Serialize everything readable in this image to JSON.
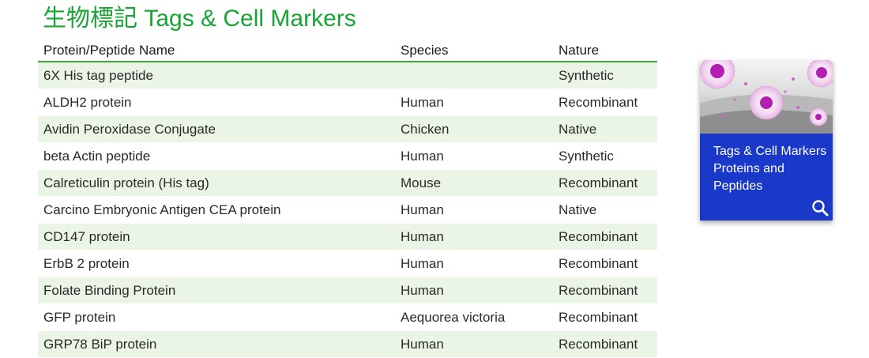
{
  "page": {
    "title": "生物標記 Tags & Cell Markers"
  },
  "table": {
    "headers": [
      "Protein/Peptide Name",
      "Species",
      "Nature"
    ],
    "rows": [
      [
        "6X His tag peptide",
        "",
        "Synthetic"
      ],
      [
        "ALDH2 protein",
        "Human",
        "Recombinant"
      ],
      [
        "Avidin Peroxidase Conjugate",
        "Chicken",
        "Native"
      ],
      [
        "beta Actin peptide",
        "Human",
        "Synthetic"
      ],
      [
        "Calreticulin protein (His tag)",
        "Mouse",
        "Recombinant"
      ],
      [
        "Carcino Embryonic Antigen CEA protein",
        "Human",
        "Native"
      ],
      [
        "CD147 protein",
        "Human",
        "Recombinant"
      ],
      [
        "ErbB 2 protein",
        "Human",
        "Recombinant"
      ],
      [
        "Folate Binding Protein",
        "Human",
        "Recombinant"
      ],
      [
        "GFP protein",
        "Aequorea victoria",
        "Recombinant"
      ],
      [
        "GRP78 BiP protein",
        "Human",
        "Recombinant"
      ]
    ]
  },
  "card": {
    "lines": [
      "Tags & Cell Markers",
      "Proteins and",
      "Peptides"
    ],
    "icon": "search-icon"
  },
  "colors": {
    "title_green": "#18a535",
    "header_rule": "#3aa935",
    "row_tint": "#eaf5e6",
    "card_blue": "#1a39c9",
    "cell_magenta": "#b01fb0"
  }
}
